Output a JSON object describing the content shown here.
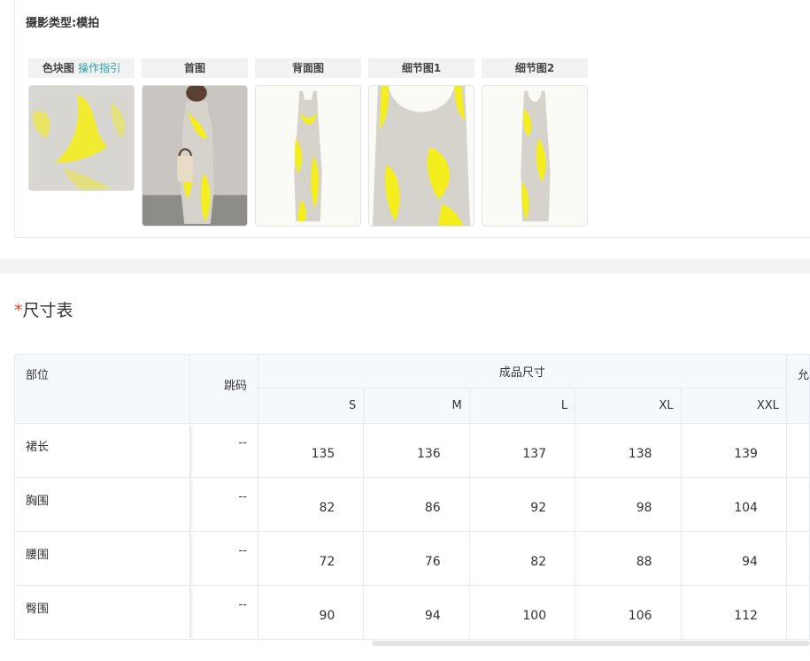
{
  "photo_section": {
    "photo_type_label": "摄影类型:模拍",
    "columns": [
      {
        "header": "色块图",
        "guide_link": "操作指引",
        "icon": "color-swatch-image"
      },
      {
        "header": "首图",
        "guide_link": "",
        "icon": "main-photo-image"
      },
      {
        "header": "背面图",
        "guide_link": "",
        "icon": "back-photo-image"
      },
      {
        "header": "细节图1",
        "guide_link": "",
        "icon": "detail-photo-image"
      },
      {
        "header": "细节图2",
        "guide_link": "",
        "icon": "detail-photo-image"
      }
    ]
  },
  "size_table": {
    "required_mark": "*",
    "title": "尺寸表",
    "headers": {
      "part": "部位",
      "skip": "跳码",
      "group": "成品尺寸",
      "sizes": [
        "S",
        "M",
        "L",
        "XL",
        "XXL"
      ],
      "extra": "允"
    },
    "rows": [
      {
        "part": "裙长",
        "skip": "--",
        "values": [
          "135",
          "136",
          "137",
          "138",
          "139"
        ]
      },
      {
        "part": "胸围",
        "skip": "--",
        "values": [
          "82",
          "86",
          "92",
          "98",
          "104"
        ]
      },
      {
        "part": "腰围",
        "skip": "--",
        "values": [
          "72",
          "76",
          "82",
          "88",
          "94"
        ]
      },
      {
        "part": "臀围",
        "skip": "--",
        "values": [
          "90",
          "94",
          "100",
          "106",
          "112"
        ]
      }
    ]
  },
  "colors": {
    "accent_link": "#2aa0a4",
    "required": "#e0472e",
    "header_bg": "#f5f8fd",
    "garment_yellow": "#f4ee1e",
    "garment_grey": "#d6d3cc"
  }
}
